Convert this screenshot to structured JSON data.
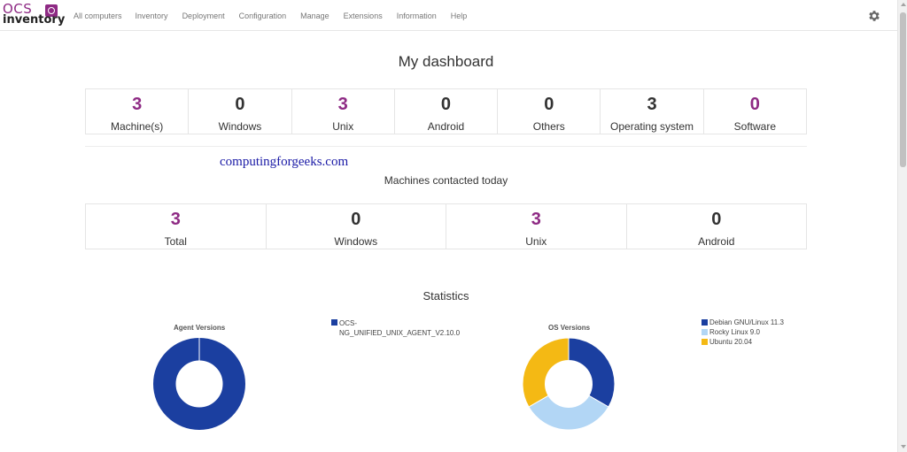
{
  "nav": {
    "logo_top": "OCS",
    "logo_bottom": "inventory",
    "items": [
      "All computers",
      "Inventory",
      "Deployment",
      "Configuration",
      "Manage",
      "Extensions",
      "Information",
      "Help"
    ],
    "settings_icon": "gear-icon"
  },
  "dashboard": {
    "title": "My dashboard",
    "stats": [
      {
        "value": "3",
        "label": "Machine(s)",
        "color": "#8e2a84"
      },
      {
        "value": "0",
        "label": "Windows",
        "color": "#333333"
      },
      {
        "value": "3",
        "label": "Unix",
        "color": "#8e2a84"
      },
      {
        "value": "0",
        "label": "Android",
        "color": "#333333"
      },
      {
        "value": "0",
        "label": "Others",
        "color": "#333333"
      },
      {
        "value": "3",
        "label": "Operating system",
        "color": "#333333"
      },
      {
        "value": "0",
        "label": "Software",
        "color": "#8e2a84"
      }
    ]
  },
  "watermark": "computingforgeeks.com",
  "contacted": {
    "title": "Machines contacted today",
    "stats": [
      {
        "value": "3",
        "label": "Total",
        "color": "#8e2a84"
      },
      {
        "value": "0",
        "label": "Windows",
        "color": "#333333"
      },
      {
        "value": "3",
        "label": "Unix",
        "color": "#8e2a84"
      },
      {
        "value": "0",
        "label": "Android",
        "color": "#333333"
      }
    ]
  },
  "statistics": {
    "title": "Statistics"
  },
  "chart_data": [
    {
      "type": "pie",
      "title": "Agent Versions",
      "categories": [
        "OCS-NG_UNIFIED_UNIX_AGENT_V2.10.0"
      ],
      "values": [
        3
      ],
      "colors": [
        "#1b3fa0"
      ],
      "legend": "right"
    },
    {
      "type": "pie",
      "title": "OS Versions",
      "categories": [
        "Debian GNU/Linux 11.3",
        "Rocky Linux 9.0",
        "Ubuntu 20.04"
      ],
      "values": [
        1,
        1,
        1
      ],
      "colors": [
        "#1b3fa0",
        "#b2d6f5",
        "#f4b914"
      ],
      "legend": "right"
    }
  ]
}
